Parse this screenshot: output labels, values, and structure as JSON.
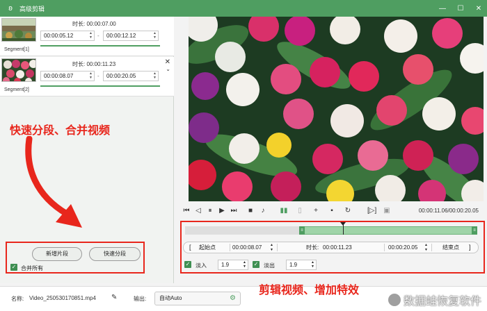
{
  "window": {
    "title": "高级剪辑"
  },
  "segments": [
    {
      "label": "Segment[1]",
      "duration_label": "时长:",
      "duration": "00:00:07.00",
      "start": "00:00:05.12",
      "end": "00:00:12.12"
    },
    {
      "label": "Segment[2]",
      "duration_label": "时长:",
      "duration": "00:00:11.23",
      "start": "00:00:08.07",
      "end": "00:00:20.05"
    }
  ],
  "annotations": {
    "left": "快速分段、合并视频",
    "right": "剪辑视频、增加特效"
  },
  "left_actions": {
    "add_segment": "新增片段",
    "quick_split": "快速分段",
    "merge_all": "合并所有"
  },
  "player": {
    "time_readout": "00:00:11.06/00:00:20.05"
  },
  "timeline": {
    "selection_start_fraction": 0.395,
    "playhead_fraction": 0.54
  },
  "range": {
    "start_label": "起始点",
    "start": "00:00:08.07",
    "duration_label": "时长:",
    "duration": "00:00:11.23",
    "end": "00:00:20.05",
    "end_label": "结束点"
  },
  "fade": {
    "fade_in_label": "淡入",
    "fade_in": "1.9",
    "fade_out_label": "淡出",
    "fade_out": "1.9"
  },
  "bottom": {
    "name_label": "名称:",
    "file_name": "Video_250530170851.mp4",
    "output_label": "输出:",
    "output_value": "自动Auto"
  },
  "watermark": "数据蛙恢复软件",
  "colors": {
    "accent": "#4f9e61",
    "annotation": "#e8261c",
    "timeline_selection": "#9fd4a8"
  }
}
